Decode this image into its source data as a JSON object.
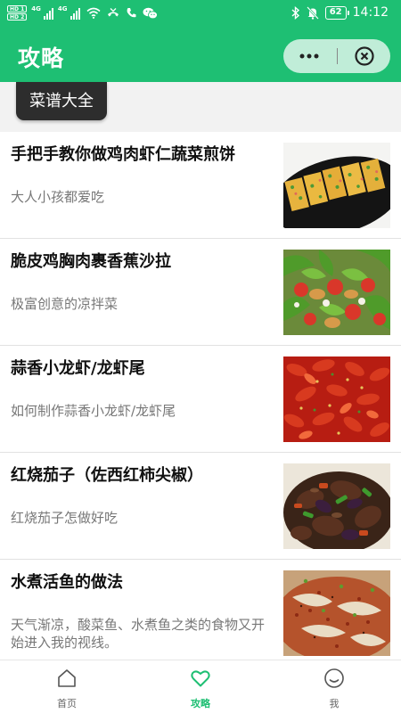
{
  "status_bar": {
    "sim1": "HD 1",
    "sim2": "HD 2",
    "network": "4G",
    "battery": "62",
    "time": "14:12"
  },
  "header": {
    "title": "攻略",
    "more_icon": "more-dots-icon",
    "close_icon": "close-circle-icon",
    "background": "#1ebf73"
  },
  "category_tag": "菜谱大全",
  "recipes": [
    {
      "title": "手把手教你做鸡肉虾仁蔬菜煎饼",
      "desc": "大人小孩都爱吃",
      "thumb": "egg-pancake-photo"
    },
    {
      "title": "脆皮鸡胸肉裹香蕉沙拉",
      "desc": "极富创意的凉拌菜",
      "thumb": "salad-photo"
    },
    {
      "title": "蒜香小龙虾/龙虾尾",
      "desc": "如何制作蒜香小龙虾/龙虾尾",
      "thumb": "crayfish-photo"
    },
    {
      "title": "红烧茄子（佐西红柿尖椒）",
      "desc": "红烧茄子怎做好吃",
      "thumb": "eggplant-photo"
    },
    {
      "title": "水煮活鱼的做法",
      "desc": "天气渐凉，酸菜鱼、水煮鱼之类的食物又开始进入我的视线。",
      "thumb": "fish-photo"
    }
  ],
  "tabbar": {
    "items": [
      {
        "label": "首页",
        "icon": "home-icon",
        "active": false
      },
      {
        "label": "攻略",
        "icon": "heart-icon",
        "active": true
      },
      {
        "label": "我",
        "icon": "smiley-icon",
        "active": false
      }
    ],
    "active_color": "#1ebf73"
  }
}
